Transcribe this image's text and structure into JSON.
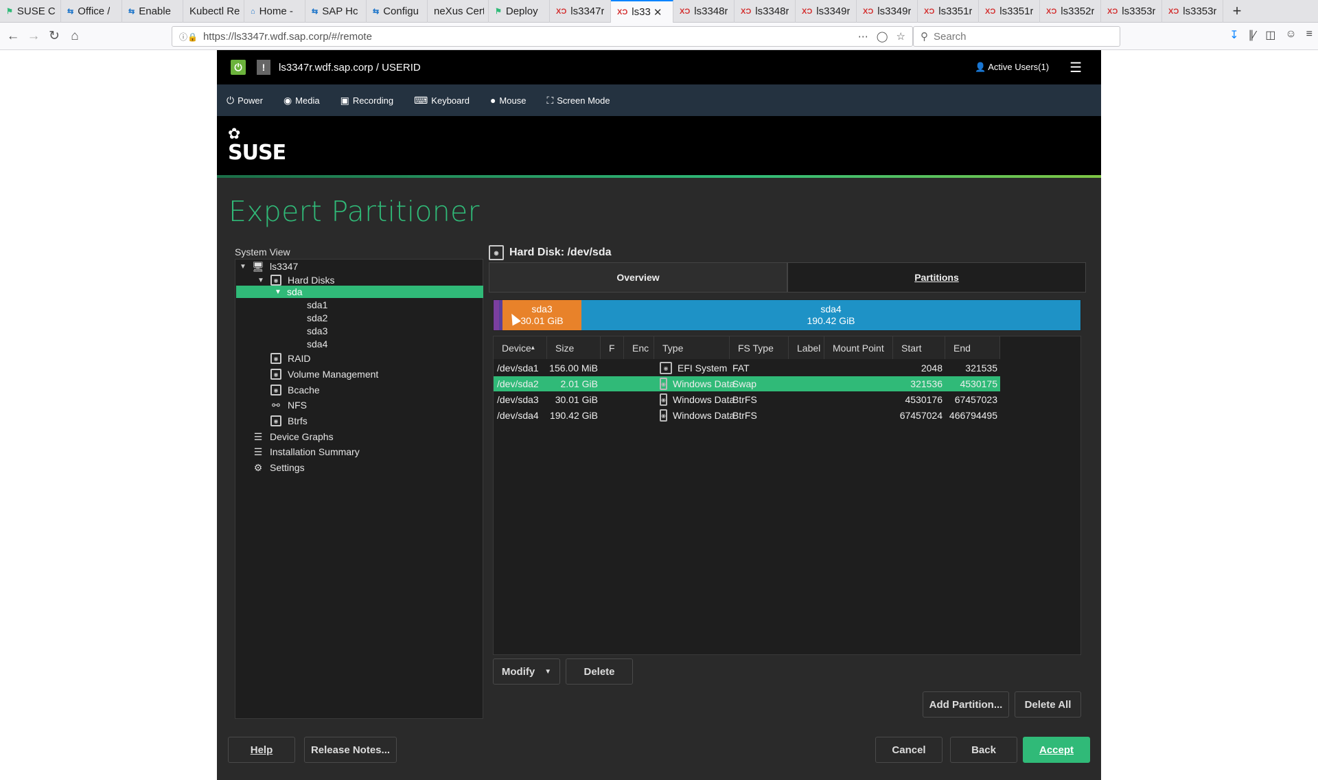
{
  "browser": {
    "tabs": [
      {
        "icon": "suse-icon",
        "title": "SUSE C"
      },
      {
        "icon": "sap-icon",
        "title": "Office /"
      },
      {
        "icon": "sap-icon",
        "title": "Enable"
      },
      {
        "icon": "",
        "title": "Kubectl Re"
      },
      {
        "icon": "home-icon",
        "title": "Home -"
      },
      {
        "icon": "sap-icon",
        "title": "SAP Hc"
      },
      {
        "icon": "sap-icon",
        "title": "Configu"
      },
      {
        "icon": "",
        "title": "neXus Cert"
      },
      {
        "icon": "suse-icon",
        "title": "Deploy"
      },
      {
        "icon": "xc-icon",
        "title": "ls3347r"
      },
      {
        "icon": "xc-icon",
        "title": "ls33",
        "active": true
      },
      {
        "icon": "xc-icon",
        "title": "ls3348r"
      },
      {
        "icon": "xc-icon",
        "title": "ls3348r"
      },
      {
        "icon": "xc-icon",
        "title": "ls3349r"
      },
      {
        "icon": "xc-icon",
        "title": "ls3349r"
      },
      {
        "icon": "xc-icon",
        "title": "ls3351r"
      },
      {
        "icon": "xc-icon",
        "title": "ls3351r"
      },
      {
        "icon": "xc-icon",
        "title": "ls3352r"
      },
      {
        "icon": "xc-icon",
        "title": "ls3353r"
      },
      {
        "icon": "xc-icon",
        "title": "ls3353r"
      }
    ],
    "url": "https://ls3347r.wdf.sap.corp/#/remote",
    "search_placeholder": "Search"
  },
  "remote": {
    "host": "ls3347r.wdf.sap.corp / USERID",
    "active_users": "Active Users(1)",
    "menu": [
      "Power",
      "Media",
      "Recording",
      "Keyboard",
      "Mouse",
      "Screen Mode"
    ]
  },
  "yast": {
    "logo": "SUSE",
    "title": "Expert Partitioner",
    "system_view_label": "System View",
    "tree": {
      "root": "ls3347",
      "hard_disks": "Hard Disks",
      "sda": "sda",
      "partitions": [
        "sda1",
        "sda2",
        "sda3",
        "sda4"
      ],
      "raid": "RAID",
      "volume_management": "Volume Management",
      "bcache": "Bcache",
      "nfs": "NFS",
      "btrfs": "Btrfs",
      "device_graphs": "Device Graphs",
      "installation_summary": "Installation Summary",
      "settings": "Settings"
    },
    "panel_title": "Hard Disk: /dev/sda",
    "tabs": {
      "overview": "Overview",
      "partitions": "Partitions"
    },
    "bar": [
      {
        "label": "sda3",
        "size": "30.01 GiB",
        "color": "#e8822a",
        "fraction": 0.135
      },
      {
        "label": "sda4",
        "size": "190.42 GiB",
        "color": "#1e92c6",
        "fraction": 0.85
      }
    ],
    "columns": [
      "Device",
      "Size",
      "F",
      "Enc",
      "Type",
      "FS Type",
      "Label",
      "Mount Point",
      "Start",
      "End"
    ],
    "rows": [
      {
        "device": "/dev/sda1",
        "size": "156.00 MiB",
        "f": "",
        "enc": "",
        "type": "EFI System",
        "fs": "FAT",
        "label": "",
        "mount": "",
        "start": "2048",
        "end": "321535"
      },
      {
        "device": "/dev/sda2",
        "size": "2.01 GiB",
        "f": "",
        "enc": "",
        "type": "Windows Data",
        "fs": "Swap",
        "label": "",
        "mount": "",
        "start": "321536",
        "end": "4530175",
        "selected": true
      },
      {
        "device": "/dev/sda3",
        "size": "30.01 GiB",
        "f": "",
        "enc": "",
        "type": "Windows Data",
        "fs": "BtrFS",
        "label": "",
        "mount": "",
        "start": "4530176",
        "end": "67457023"
      },
      {
        "device": "/dev/sda4",
        "size": "190.42 GiB",
        "f": "",
        "enc": "",
        "type": "Windows Data",
        "fs": "BtrFS",
        "label": "",
        "mount": "",
        "start": "67457024",
        "end": "466794495"
      }
    ],
    "buttons": {
      "modify": "Modify",
      "delete": "Delete",
      "add_partition": "Add Partition...",
      "delete_all": "Delete All",
      "help": "Help",
      "release_notes": "Release Notes...",
      "cancel": "Cancel",
      "back": "Back",
      "accept": "Accept"
    },
    "accent_color": "#30ba78"
  }
}
